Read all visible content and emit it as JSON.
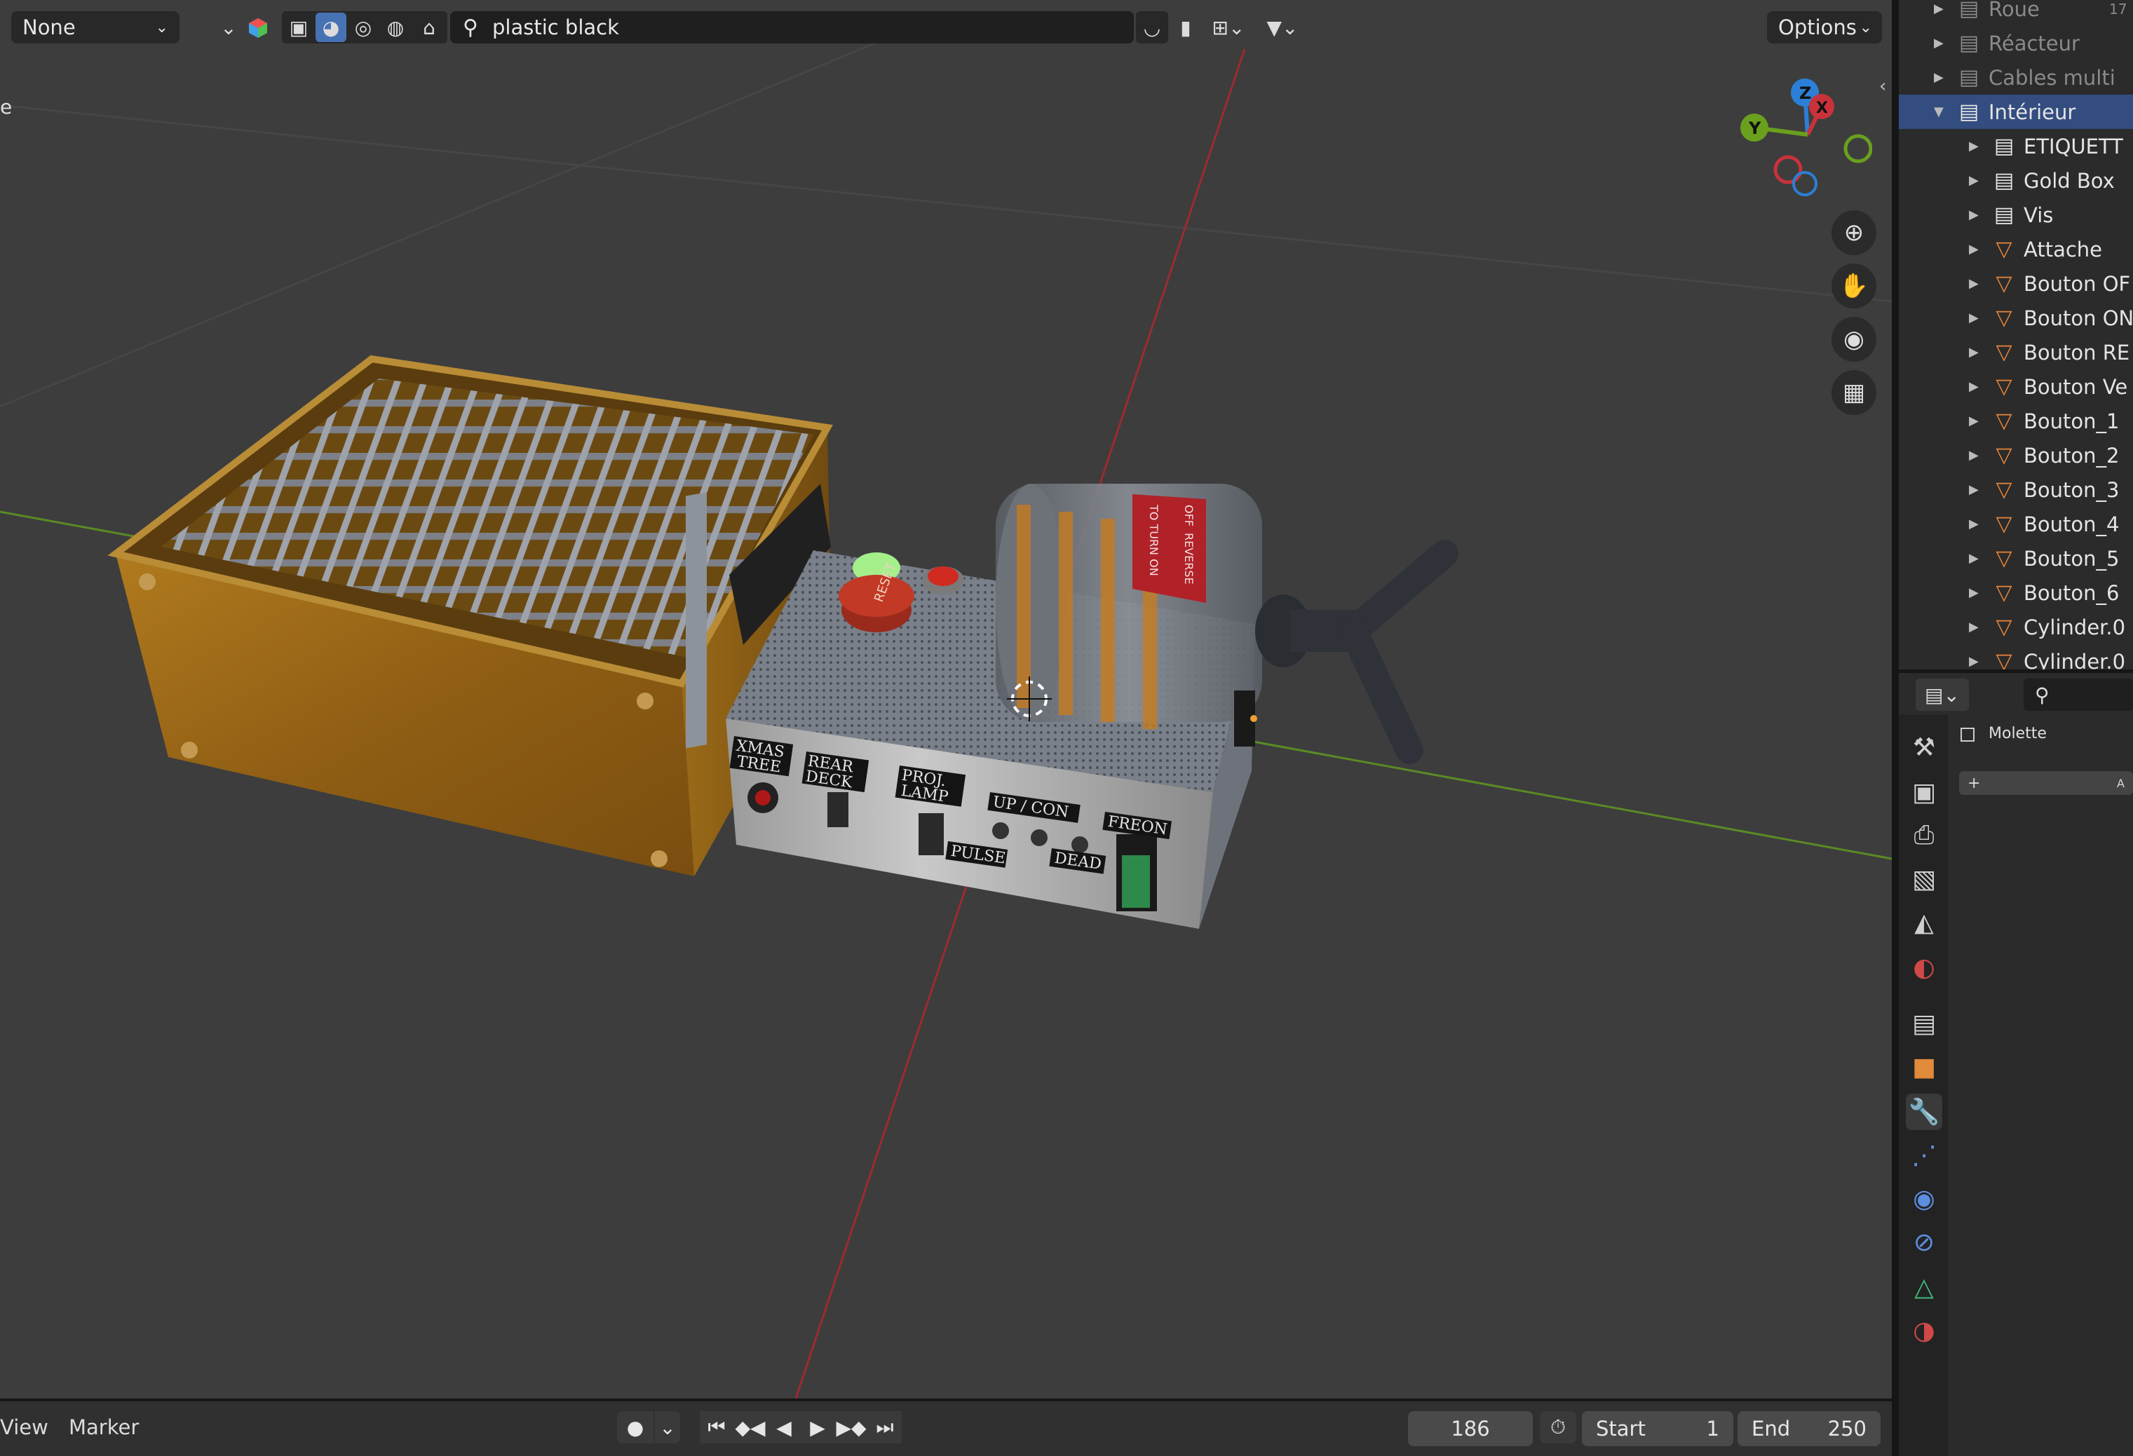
{
  "viewport_header": {
    "mode_select": "None",
    "search_value": "plastic black",
    "options_label": "Options"
  },
  "viewport": {
    "edge_text": "e",
    "gizmo": {
      "z": "Z",
      "x": "X",
      "y": "Y"
    },
    "nav_icons": [
      "zoom-icon",
      "hand-pan-icon",
      "camera-icon",
      "grid-perspective-icon"
    ]
  },
  "timeline": {
    "menu": [
      "View",
      "Marker"
    ],
    "current_frame": "186",
    "start_label": "Start",
    "start_value": "1",
    "end_label": "End",
    "end_value": "250"
  },
  "outliner": {
    "items": [
      {
        "label": "Roue",
        "type": "collection",
        "depth": 0,
        "dim": true,
        "extra": "17"
      },
      {
        "label": "Réacteur",
        "type": "collection",
        "depth": 0,
        "dim": true
      },
      {
        "label": "Cables multi",
        "type": "collection",
        "depth": 0,
        "dim": true
      },
      {
        "label": "Intérieur",
        "type": "collection",
        "depth": 0,
        "selected": true,
        "expanded": true
      },
      {
        "label": "ETIQUETT",
        "type": "collection",
        "depth": 1
      },
      {
        "label": "Gold Box",
        "type": "collection",
        "depth": 1
      },
      {
        "label": "Vis",
        "type": "collection",
        "depth": 1
      },
      {
        "label": "Attache",
        "type": "mesh",
        "depth": 1
      },
      {
        "label": "Bouton OF",
        "type": "mesh",
        "depth": 1
      },
      {
        "label": "Bouton ON",
        "type": "mesh",
        "depth": 1
      },
      {
        "label": "Bouton RE",
        "type": "mesh",
        "depth": 1
      },
      {
        "label": "Bouton Ve",
        "type": "mesh",
        "depth": 1
      },
      {
        "label": "Bouton_1",
        "type": "mesh",
        "depth": 1
      },
      {
        "label": "Bouton_2",
        "type": "mesh",
        "depth": 1
      },
      {
        "label": "Bouton_3",
        "type": "mesh",
        "depth": 1
      },
      {
        "label": "Bouton_4",
        "type": "mesh",
        "depth": 1
      },
      {
        "label": "Bouton_5",
        "type": "mesh",
        "depth": 1
      },
      {
        "label": "Bouton_6",
        "type": "mesh",
        "depth": 1
      },
      {
        "label": "Cylinder.0",
        "type": "mesh",
        "depth": 1
      },
      {
        "label": "Cylinder.0",
        "type": "mesh",
        "depth": 1
      }
    ]
  },
  "properties": {
    "object_name": "Molette",
    "add_label": "+",
    "add_suffix": "A",
    "tabs": [
      "tool-icon",
      "render-icon",
      "output-icon",
      "view-layer-icon",
      "scene-icon",
      "world-icon",
      "collection-icon",
      "object-icon",
      "modifier-icon",
      "particles-icon",
      "physics-icon",
      "constraints-icon",
      "data-icon",
      "material-icon"
    ],
    "active_tab": "modifier-icon"
  },
  "model_labels": [
    "XMAS TREE",
    "REAR DECK",
    "PROJ. LAMP",
    "UP / CON",
    "PULSE",
    "DEAD",
    "FREON",
    "RESET",
    "TO TURN ON",
    "OFF",
    "REVERSE"
  ],
  "colors": {
    "viewport_bg": "#3d3d3d",
    "selection_blue": "#4772b3",
    "x_axis": "#c8323a",
    "y_axis": "#6aa01e",
    "z_axis": "#2c7fd6",
    "mesh_orange": "#e8863a"
  }
}
